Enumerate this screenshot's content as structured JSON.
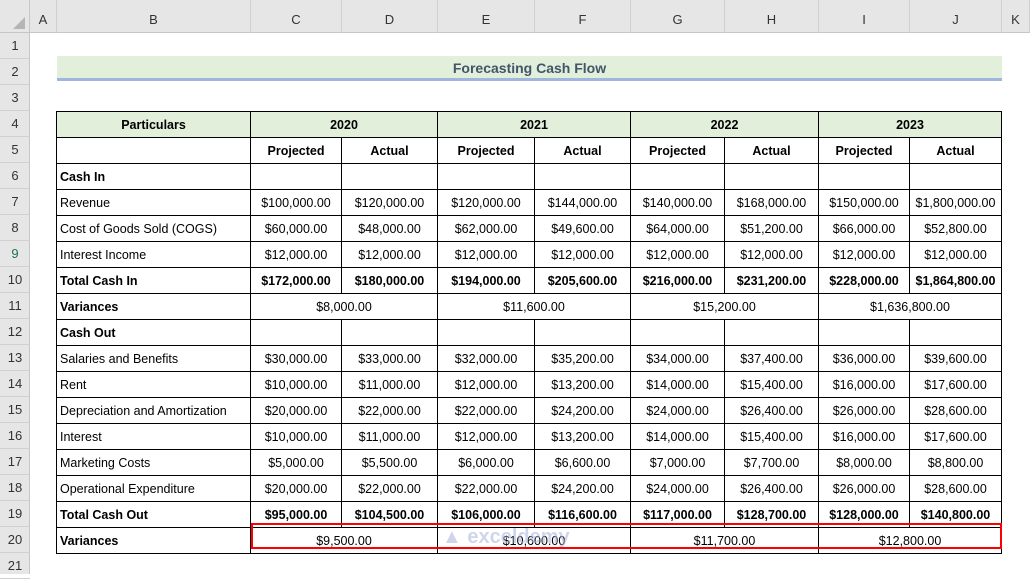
{
  "columns": [
    "A",
    "B",
    "C",
    "D",
    "E",
    "F",
    "G",
    "H",
    "I",
    "J",
    "K"
  ],
  "rows": [
    "1",
    "2",
    "3",
    "4",
    "5",
    "6",
    "7",
    "8",
    "9",
    "10",
    "11",
    "12",
    "13",
    "14",
    "15",
    "16",
    "17",
    "18",
    "19",
    "20",
    "21"
  ],
  "title": "Forecasting Cash Flow",
  "header": {
    "particulars": "Particulars",
    "years": [
      "2020",
      "2021",
      "2022",
      "2023"
    ],
    "projected": "Projected",
    "actual": "Actual"
  },
  "table": [
    {
      "label": "Cash In",
      "bold": true,
      "type": "section",
      "values": []
    },
    {
      "label": "Revenue",
      "values": [
        "$100,000.00",
        "$120,000.00",
        "$120,000.00",
        "$144,000.00",
        "$140,000.00",
        "$168,000.00",
        "$150,000.00",
        "$1,800,000.00"
      ]
    },
    {
      "label": "Cost of Goods Sold (COGS)",
      "values": [
        "$60,000.00",
        "$48,000.00",
        "$62,000.00",
        "$49,600.00",
        "$64,000.00",
        "$51,200.00",
        "$66,000.00",
        "$52,800.00"
      ]
    },
    {
      "label": "Interest Income",
      "values": [
        "$12,000.00",
        "$12,000.00",
        "$12,000.00",
        "$12,000.00",
        "$12,000.00",
        "$12,000.00",
        "$12,000.00",
        "$12,000.00"
      ]
    },
    {
      "label": "Total Cash In",
      "bold": true,
      "values": [
        "$172,000.00",
        "$180,000.00",
        "$194,000.00",
        "$205,600.00",
        "$216,000.00",
        "$231,200.00",
        "$228,000.00",
        "$1,864,800.00"
      ]
    },
    {
      "label": "Variances",
      "bold": true,
      "type": "merged",
      "values": [
        "$8,000.00",
        "$11,600.00",
        "$15,200.00",
        "$1,636,800.00"
      ]
    },
    {
      "label": "Cash Out",
      "bold": true,
      "type": "section",
      "values": []
    },
    {
      "label": "Salaries and Benefits",
      "values": [
        "$30,000.00",
        "$33,000.00",
        "$32,000.00",
        "$35,200.00",
        "$34,000.00",
        "$37,400.00",
        "$36,000.00",
        "$39,600.00"
      ]
    },
    {
      "label": "Rent",
      "values": [
        "$10,000.00",
        "$11,000.00",
        "$12,000.00",
        "$13,200.00",
        "$14,000.00",
        "$15,400.00",
        "$16,000.00",
        "$17,600.00"
      ]
    },
    {
      "label": "Depreciation and Amortization",
      "values": [
        "$20,000.00",
        "$22,000.00",
        "$22,000.00",
        "$24,200.00",
        "$24,000.00",
        "$26,400.00",
        "$26,000.00",
        "$28,600.00"
      ]
    },
    {
      "label": "Interest",
      "values": [
        "$10,000.00",
        "$11,000.00",
        "$12,000.00",
        "$13,200.00",
        "$14,000.00",
        "$15,400.00",
        "$16,000.00",
        "$17,600.00"
      ]
    },
    {
      "label": "Marketing Costs",
      "values": [
        "$5,000.00",
        "$5,500.00",
        "$6,000.00",
        "$6,600.00",
        "$7,000.00",
        "$7,700.00",
        "$8,000.00",
        "$8,800.00"
      ]
    },
    {
      "label": "Operational Expenditure",
      "values": [
        "$20,000.00",
        "$22,000.00",
        "$22,000.00",
        "$24,200.00",
        "$24,000.00",
        "$26,400.00",
        "$26,000.00",
        "$28,600.00"
      ]
    },
    {
      "label": "Total Cash Out",
      "bold": true,
      "values": [
        "$95,000.00",
        "$104,500.00",
        "$106,000.00",
        "$116,600.00",
        "$117,000.00",
        "$128,700.00",
        "$128,000.00",
        "$140,800.00"
      ]
    },
    {
      "label": "Variances",
      "bold": true,
      "type": "merged",
      "values": [
        "$9,500.00",
        "$10,600.00",
        "$11,700.00",
        "$12,800.00"
      ]
    }
  ],
  "watermark": "exceldemy",
  "colors": {
    "header_fill": "#e2efda",
    "highlight": "#ff0000",
    "title_text": "#44546a"
  }
}
